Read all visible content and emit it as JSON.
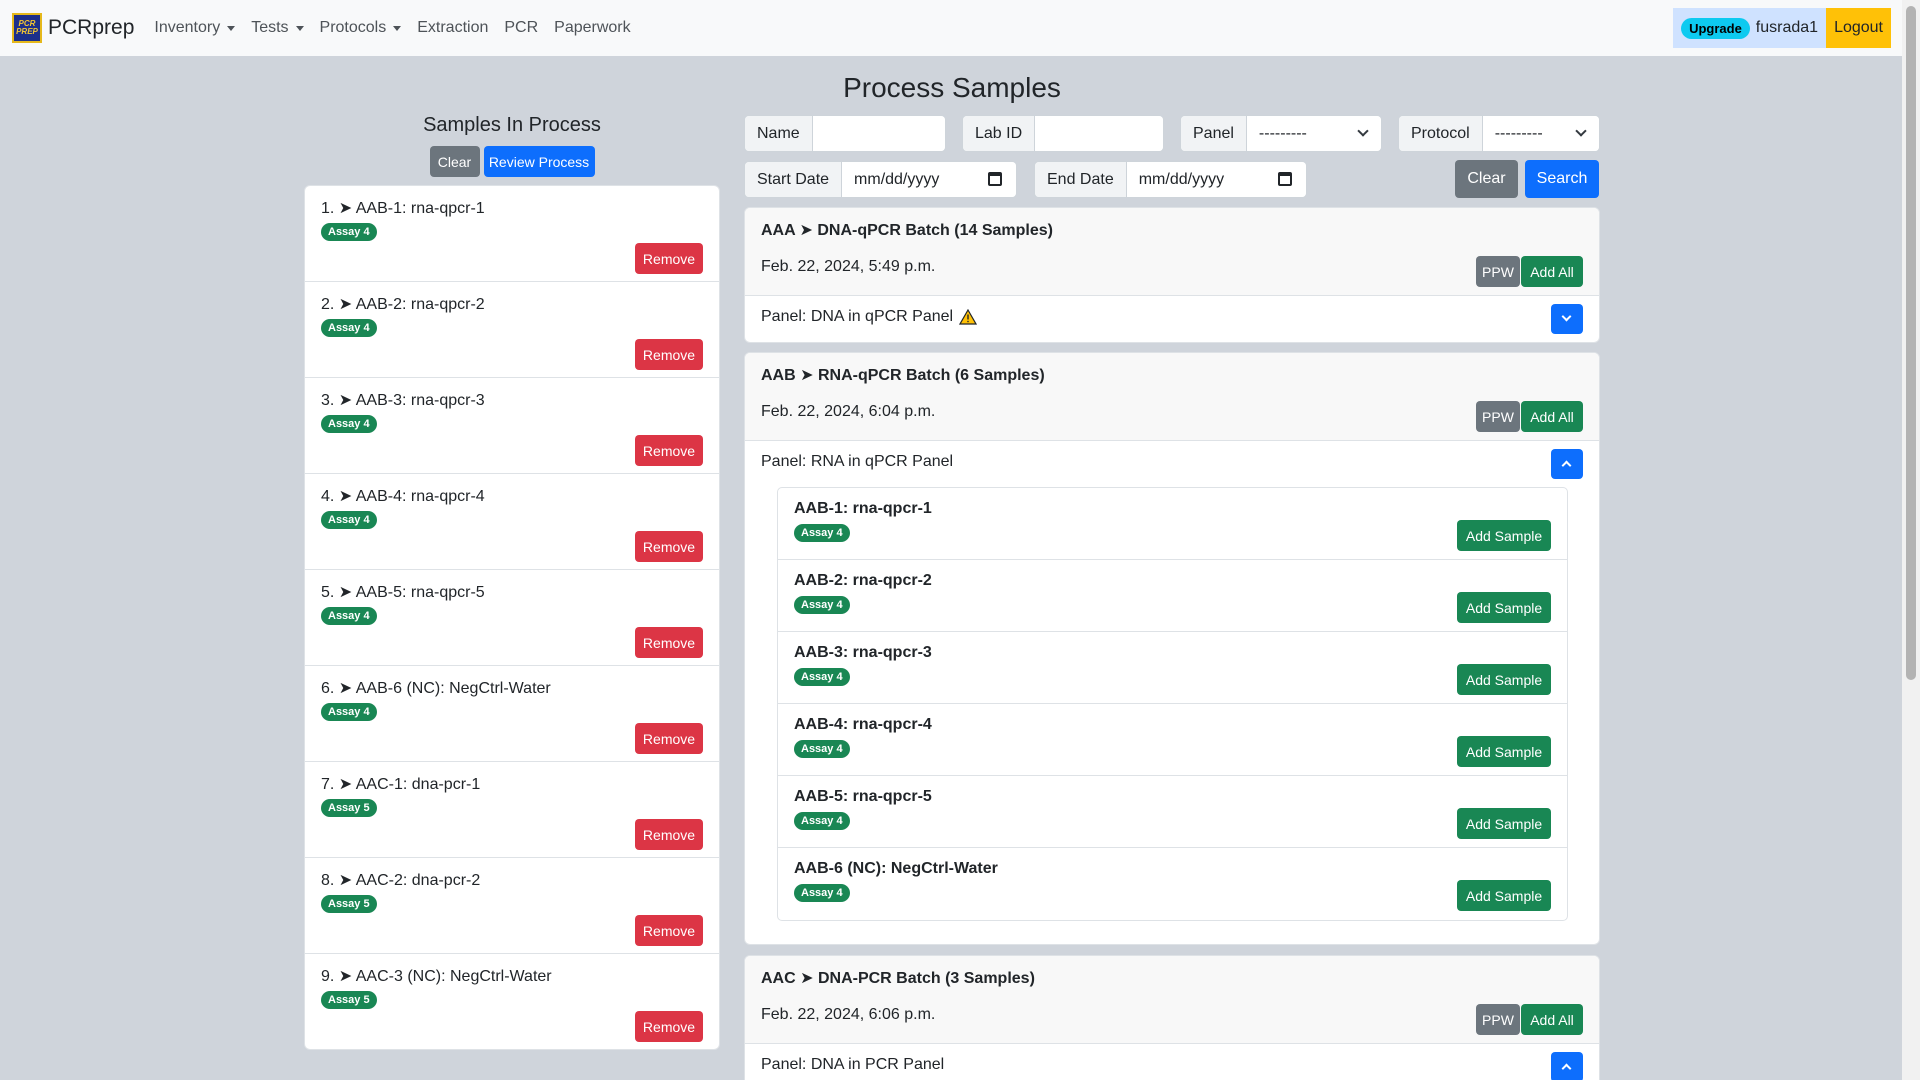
{
  "navbar": {
    "brand": "PCRprep",
    "logo_text": "PCR PREP",
    "links": [
      {
        "label": "Inventory",
        "dropdown": true
      },
      {
        "label": "Tests",
        "dropdown": true
      },
      {
        "label": "Protocols",
        "dropdown": true
      },
      {
        "label": "Extraction",
        "dropdown": false
      },
      {
        "label": "PCR",
        "dropdown": false
      },
      {
        "label": "Paperwork",
        "dropdown": false
      }
    ],
    "upgrade": "Upgrade",
    "username": "fusrada1",
    "logout": "Logout"
  },
  "page_title": "Process Samples",
  "left": {
    "title": "Samples In Process",
    "clear": "Clear",
    "review": "Review Process",
    "remove_label": "Remove",
    "items": [
      {
        "text": "1. ➤ AAB-1: rna-qpcr-1",
        "badge": "Assay 4"
      },
      {
        "text": "2. ➤ AAB-2: rna-qpcr-2",
        "badge": "Assay 4"
      },
      {
        "text": "3. ➤ AAB-3: rna-qpcr-3",
        "badge": "Assay 4"
      },
      {
        "text": "4. ➤ AAB-4: rna-qpcr-4",
        "badge": "Assay 4"
      },
      {
        "text": "5. ➤ AAB-5: rna-qpcr-5",
        "badge": "Assay 4"
      },
      {
        "text": "6. ➤ AAB-6 (NC): NegCtrl-Water",
        "badge": "Assay 4"
      },
      {
        "text": "7. ➤ AAC-1: dna-pcr-1",
        "badge": "Assay 5"
      },
      {
        "text": "8. ➤ AAC-2: dna-pcr-2",
        "badge": "Assay 5"
      },
      {
        "text": "9. ➤ AAC-3 (NC): NegCtrl-Water",
        "badge": "Assay 5"
      }
    ]
  },
  "filters": {
    "name_label": "Name",
    "name_value": "",
    "labid_label": "Lab ID",
    "labid_value": "",
    "panel_label": "Panel",
    "panel_value": "---------",
    "protocol_label": "Protocol",
    "protocol_value": "---------",
    "start_label": "Start Date",
    "start_placeholder": "mm/dd/yyyy",
    "end_label": "End Date",
    "end_placeholder": "mm/dd/yyyy",
    "clear": "Clear",
    "search": "Search"
  },
  "batches": [
    {
      "title": "AAA ➤ DNA-qPCR Batch (14 Samples)",
      "date": "Feb. 22, 2024, 5:49 p.m.",
      "ppw": "PPW",
      "add_all": "Add All",
      "panel": "Panel: DNA in qPCR Panel",
      "warning": true,
      "expanded": false
    },
    {
      "title": "AAB ➤ RNA-qPCR Batch (6 Samples)",
      "date": "Feb. 22, 2024, 6:04 p.m.",
      "ppw": "PPW",
      "add_all": "Add All",
      "panel": "Panel: RNA in qPCR Panel",
      "warning": false,
      "expanded": true,
      "add_sample_label": "Add Sample",
      "samples": [
        {
          "name": "AAB-1: rna-qpcr-1",
          "badge": "Assay 4"
        },
        {
          "name": "AAB-2: rna-qpcr-2",
          "badge": "Assay 4"
        },
        {
          "name": "AAB-3: rna-qpcr-3",
          "badge": "Assay 4"
        },
        {
          "name": "AAB-4: rna-qpcr-4",
          "badge": "Assay 4"
        },
        {
          "name": "AAB-5: rna-qpcr-5",
          "badge": "Assay 4"
        },
        {
          "name": "AAB-6 (NC): NegCtrl-Water",
          "badge": "Assay 4"
        }
      ]
    },
    {
      "title": "AAC ➤ DNA-PCR Batch (3 Samples)",
      "date": "Feb. 22, 2024, 6:06 p.m.",
      "ppw": "PPW",
      "add_all": "Add All",
      "panel": "Panel: DNA in PCR Panel",
      "warning": false,
      "expanded": true
    }
  ]
}
